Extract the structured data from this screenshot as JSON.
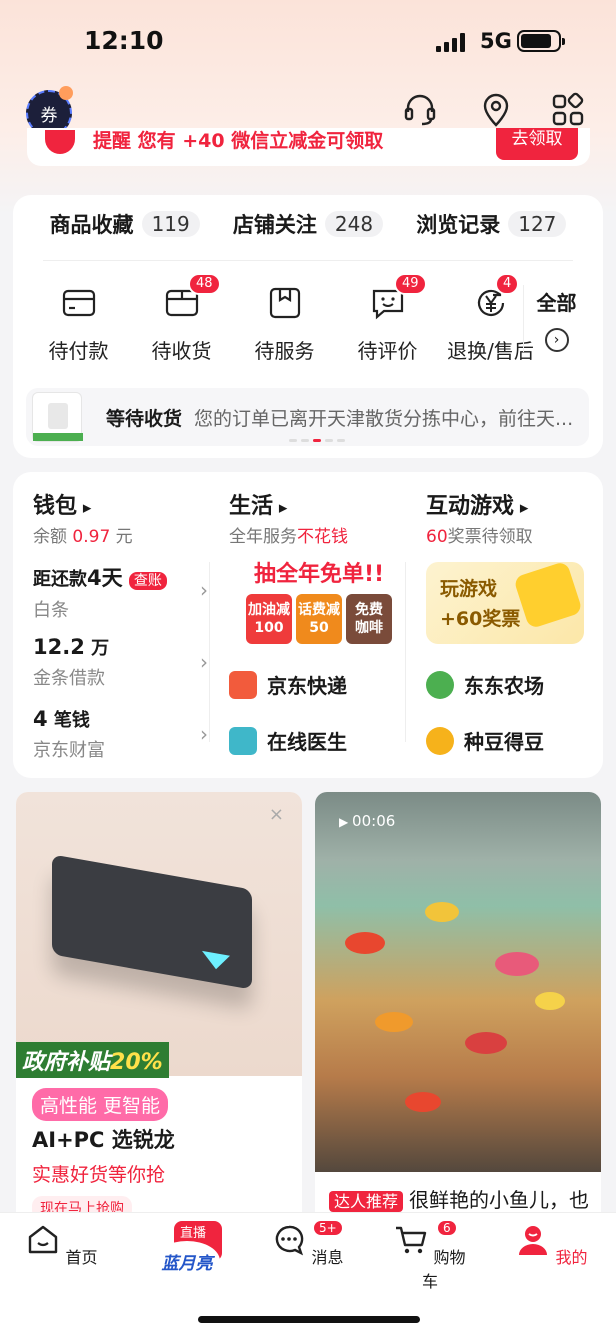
{
  "status": {
    "time": "12:10",
    "network": "5G"
  },
  "coupon_avatar_label": "券",
  "reminder": {
    "text": "提醒  您有 +40 微信立减金可领取",
    "button": "去领取"
  },
  "stats": [
    {
      "label": "商品收藏",
      "count": "119"
    },
    {
      "label": "店铺关注",
      "count": "248"
    },
    {
      "label": "浏览记录",
      "count": "127"
    }
  ],
  "orders": [
    {
      "label": "待付款",
      "badge": ""
    },
    {
      "label": "待收货",
      "badge": "48"
    },
    {
      "label": "待服务",
      "badge": ""
    },
    {
      "label": "待评价",
      "badge": "49"
    },
    {
      "label": "退换/售后",
      "badge": "4"
    }
  ],
  "orders_all_label": "全部",
  "tracking": {
    "label": "等待收货",
    "text": "您的订单已离开天津散货分拣中心，前往天..."
  },
  "wallet": {
    "title": "钱包",
    "balance_prefix": "余额",
    "balance_value": "0.97",
    "balance_unit": "元",
    "rows": [
      {
        "main_a": "距还款",
        "main_b": "4天",
        "tag": "查账",
        "sub": "白条"
      },
      {
        "main_a": "12.2",
        "main_b": "万",
        "tag": "",
        "sub": "金条借款"
      },
      {
        "main_a": "4",
        "main_b": "笔钱",
        "tag": "",
        "sub": "京东财富"
      }
    ]
  },
  "life": {
    "title": "生活",
    "sub_a": "全年服务",
    "sub_b": "不花钱",
    "promo_title": "抽全年免单!!",
    "tickets": [
      {
        "line1": "加油减",
        "line2": "100",
        "color": "#ef3b3b"
      },
      {
        "line1": "话费减",
        "line2": "50",
        "color": "#f08a1c"
      },
      {
        "line1": "免费",
        "line2": "咖啡",
        "color": "#7a4b3a"
      }
    ],
    "services": [
      "京东快递",
      "在线医生"
    ]
  },
  "games": {
    "title": "互动游戏",
    "sub_a": "60",
    "sub_b": "奖票待领取",
    "card_line1": "玩游戏",
    "card_line2": "+60奖票",
    "services": [
      "东东农场",
      "种豆得豆"
    ]
  },
  "feed_left": {
    "subsidy_a": "政府补贴",
    "subsidy_b": "20%",
    "tag": "高性能 更智能",
    "title": "AI+PC 选锐龙",
    "subtitle": "实惠好货等你抢",
    "hint": "现在马上抢购"
  },
  "feed_right": {
    "duration": "00:06",
    "tag": "达人推荐",
    "caption": "很鲜艳的小鱼儿，也"
  },
  "tabbar": {
    "home": "首页",
    "live_pill": "直播中",
    "live_logo": "蓝月亮",
    "messages": "消息",
    "messages_badge": "5+",
    "cart": "购物车",
    "cart_badge": "6",
    "me": "我的"
  },
  "colors": {
    "accent": "#f0243e",
    "background": "#f4f4f6"
  }
}
